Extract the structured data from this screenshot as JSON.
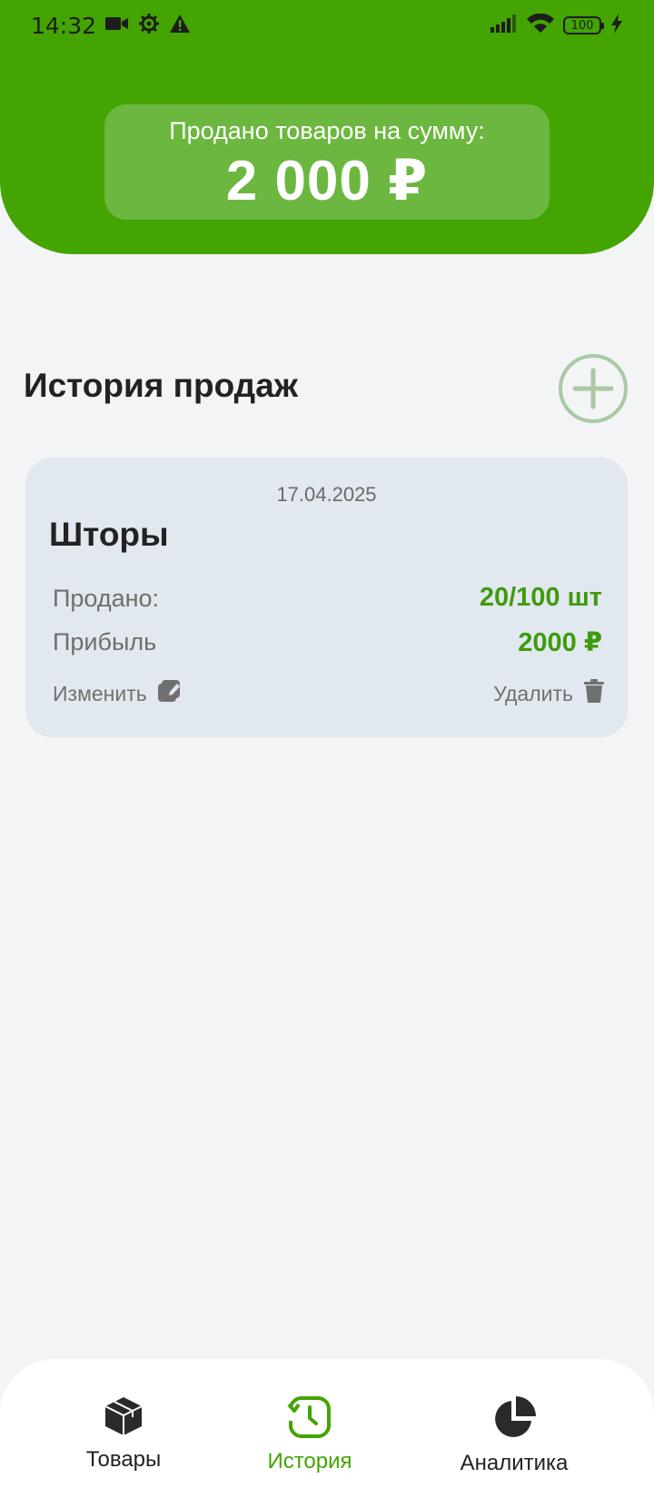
{
  "status_bar": {
    "time": "14:32",
    "battery": "100",
    "icons": [
      "video-camera-icon",
      "settings-icon",
      "warning-icon",
      "signal-icon",
      "wifi-icon",
      "battery-icon",
      "charging-icon"
    ]
  },
  "summary": {
    "label": "Продано товаров на сумму:",
    "value": "2 000 ₽"
  },
  "section": {
    "title": "История продаж"
  },
  "sales": [
    {
      "date": "17.04.2025",
      "name": "Шторы",
      "sold_label": "Продано:",
      "sold_value": "20/100 шт",
      "profit_label": "Прибыль",
      "profit_value": "2000 ₽",
      "edit_label": "Изменить",
      "delete_label": "Удалить"
    }
  ],
  "nav": {
    "items": [
      {
        "label": "Товары",
        "icon": "box-icon",
        "active": false
      },
      {
        "label": "История",
        "icon": "history-icon",
        "active": true
      },
      {
        "label": "Аналитика",
        "icon": "pie-chart-icon",
        "active": false
      }
    ]
  },
  "colors": {
    "accent": "#43a402",
    "summary_card": "#6cb73f",
    "card_bg": "#e2e8ef",
    "value_green": "#3e9b0d",
    "background": "#f2f4f6"
  }
}
